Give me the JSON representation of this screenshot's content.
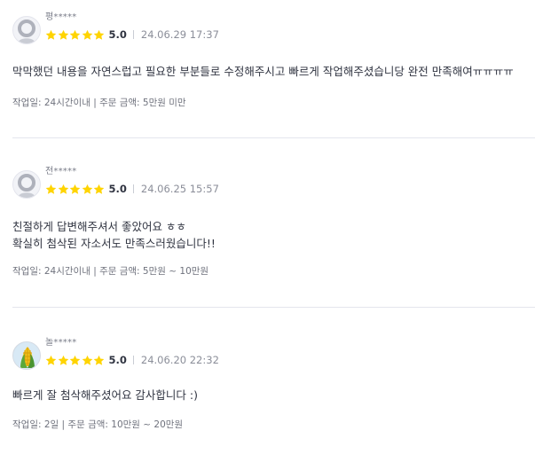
{
  "reviews": [
    {
      "nickname": "평*****",
      "score": "5.0",
      "stars": 5,
      "date": "24.06.29 17:37",
      "content_lines": [
        "막막했던 내용을 자연스럽고 필요한 부분들로 수정해주시고 빠르게 작업해주셨습니당 완전 만족해여ㅠㅠㅠㅠ"
      ],
      "info": "작업일: 24시간이내 | 주문 금액: 5만원 미만",
      "avatar": "default-profile-icon"
    },
    {
      "nickname": "전*****",
      "score": "5.0",
      "stars": 5,
      "date": "24.06.25 15:57",
      "content_lines": [
        "친절하게 답변해주셔서 좋았어요 ㅎㅎ",
        "확실히 첨삭된 자소서도 만족스러웠습니다!!"
      ],
      "info": "작업일: 24시간이내 | 주문 금액: 5만원 ~ 10만원",
      "avatar": "default-profile-icon"
    },
    {
      "nickname": "놀*****",
      "score": "5.0",
      "stars": 5,
      "date": "24.06.20 22:32",
      "content_lines": [
        "빠르게 잘 첨삭해주셨어요 감사합니다 :)"
      ],
      "info": "작업일: 2일 | 주문 금액: 10만원 ~ 20만원",
      "avatar": "corn-profile-image"
    }
  ],
  "colors": {
    "star": "#FFD400",
    "text": "#303441",
    "muted": "#8B8E99",
    "divider": "#E4E5ED"
  }
}
